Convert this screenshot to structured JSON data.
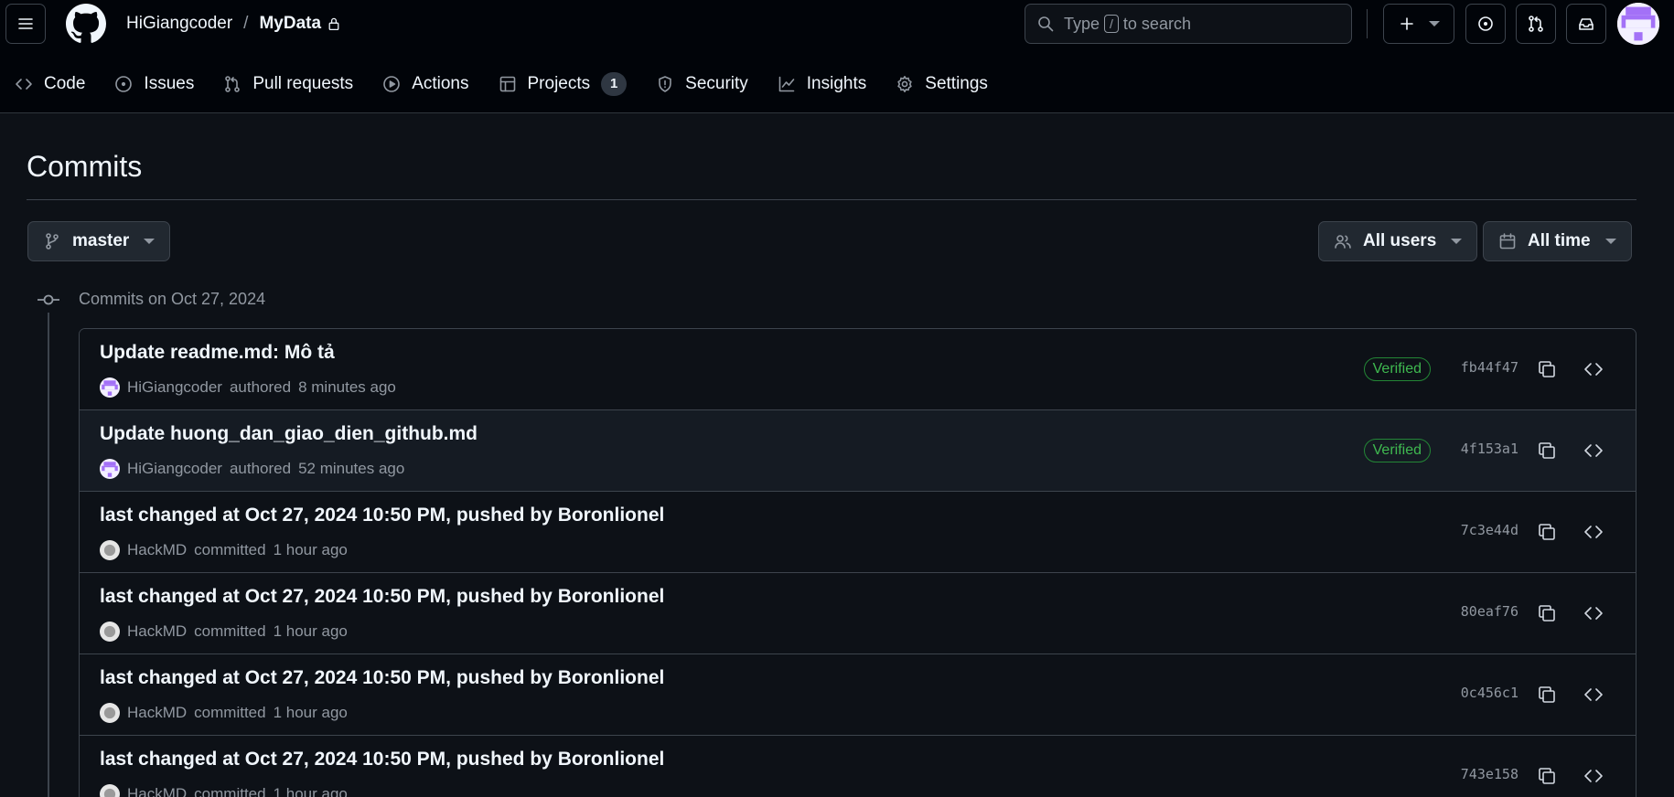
{
  "header": {
    "owner": "HiGiangcoder",
    "separator": "/",
    "repo": "MyData",
    "search": {
      "prefix": "Type",
      "key": "/",
      "suffix": "to search"
    },
    "icons": [
      "hamburger-icon",
      "github-logo",
      "lock-icon",
      "search-icon",
      "plus-icon",
      "issue-icon",
      "pull-request-icon",
      "inbox-icon"
    ]
  },
  "nav": {
    "code": "Code",
    "issues": "Issues",
    "pulls": "Pull requests",
    "actions": "Actions",
    "projects": "Projects",
    "projects_count": "1",
    "security": "Security",
    "insights": "Insights",
    "settings": "Settings"
  },
  "page": {
    "title": "Commits",
    "branch": "master",
    "users_filter": "All users",
    "time_filter": "All time",
    "group_label": "Commits on Oct 27, 2024"
  },
  "commits": [
    {
      "title": "Update readme.md: Mô tả",
      "author": "HiGiangcoder",
      "action": "authored",
      "time": "8 minutes ago",
      "verified": "Verified",
      "sha": "fb44f47"
    },
    {
      "title": "Update huong_dan_giao_dien_github.md",
      "author": "HiGiangcoder",
      "action": "authored",
      "time": "52 minutes ago",
      "verified": "Verified",
      "sha": "4f153a1"
    },
    {
      "title": "last changed at Oct 27, 2024 10:50 PM, pushed by Boronlionel",
      "author": "HackMD",
      "action": "committed",
      "time": "1 hour ago",
      "sha": "7c3e44d"
    },
    {
      "title": "last changed at Oct 27, 2024 10:50 PM, pushed by Boronlionel",
      "author": "HackMD",
      "action": "committed",
      "time": "1 hour ago",
      "sha": "80eaf76"
    },
    {
      "title": "last changed at Oct 27, 2024 10:50 PM, pushed by Boronlionel",
      "author": "HackMD",
      "action": "committed",
      "time": "1 hour ago",
      "sha": "0c456c1"
    },
    {
      "title": "last changed at Oct 27, 2024 10:50 PM, pushed by Boronlionel",
      "author": "HackMD",
      "action": "committed",
      "time": "1 hour ago",
      "sha": "743e158"
    }
  ],
  "colors": {
    "bg": "#0d1117",
    "header_bg": "#010409",
    "border": "#3d444d",
    "verified": "#3fb950",
    "avatar_accent": "#a371f7"
  }
}
